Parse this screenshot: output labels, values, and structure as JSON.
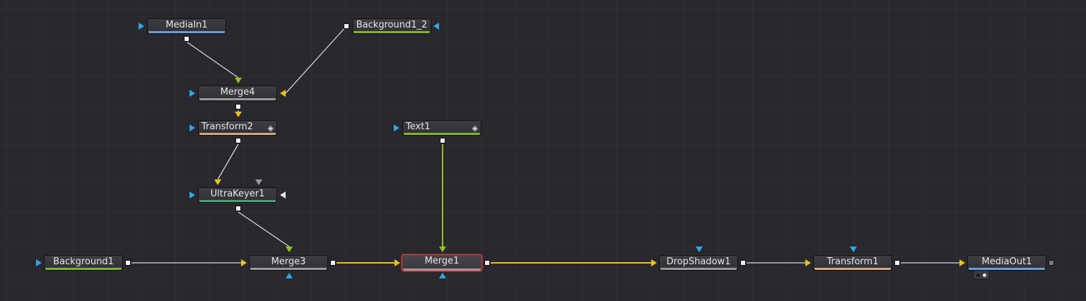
{
  "colors": {
    "yellow": "#e8c21e",
    "blue": "#2ca8e8",
    "green": "#8cc420",
    "white": "#e8e8e8",
    "grey": "#9a9a9a",
    "line_white": "#d8d8d8",
    "line_yellow": "#e8c21e",
    "line_green": "#8cc420"
  },
  "nodes": [
    {
      "id": "mediain1",
      "label": "MediaIn1",
      "bar": "#6a9fd8",
      "icon": ""
    },
    {
      "id": "background1_2",
      "label": "Background1_2",
      "bar": "#7cb82c",
      "icon": ""
    },
    {
      "id": "merge4",
      "label": "Merge4",
      "bar": "#9a9aa0",
      "icon": ""
    },
    {
      "id": "transform2",
      "label": "Transform2",
      "bar": "#d8a878",
      "icon": "keyframe-diamond-icon"
    },
    {
      "id": "text1",
      "label": "Text1",
      "bar": "#7cb82c",
      "icon": "keyframe-diamond-icon"
    },
    {
      "id": "ultrakeyer1",
      "label": "UltraKeyer1",
      "bar": "#3aa870",
      "icon": ""
    },
    {
      "id": "background1",
      "label": "Background1",
      "bar": "#7cb82c",
      "icon": ""
    },
    {
      "id": "merge3",
      "label": "Merge3",
      "bar": "#9a9aa0",
      "icon": ""
    },
    {
      "id": "merge1",
      "label": "Merge1",
      "bar": "#9a9aa0",
      "icon": "",
      "selected": true
    },
    {
      "id": "dropshadow1",
      "label": "DropShadow1",
      "bar": "#9a9aa0",
      "icon": ""
    },
    {
      "id": "transform1",
      "label": "Transform1",
      "bar": "#d8a878",
      "icon": ""
    },
    {
      "id": "mediaout1",
      "label": "MediaOut1",
      "bar": "#6a9fd8",
      "icon": ""
    }
  ],
  "connections": [
    {
      "from": "mediain1",
      "to": "merge4",
      "input": "background"
    },
    {
      "from": "background1_2",
      "to": "merge4",
      "input": "foreground"
    },
    {
      "from": "merge4",
      "to": "transform2",
      "input": "background"
    },
    {
      "from": "transform2",
      "to": "ultrakeyer1",
      "input": "background"
    },
    {
      "from": "ultrakeyer1",
      "to": "merge3",
      "input": "foreground"
    },
    {
      "from": "background1",
      "to": "merge3",
      "input": "background"
    },
    {
      "from": "merge3",
      "to": "merge1",
      "input": "background"
    },
    {
      "from": "text1",
      "to": "merge1",
      "input": "foreground"
    },
    {
      "from": "merge1",
      "to": "dropshadow1",
      "input": "background"
    },
    {
      "from": "dropshadow1",
      "to": "transform1",
      "input": "background"
    },
    {
      "from": "transform1",
      "to": "mediaout1",
      "input": "input"
    }
  ],
  "mediaout_view_indicator": {
    "dot1": "#1a1a1a",
    "dot2": "#e8e8e8"
  }
}
